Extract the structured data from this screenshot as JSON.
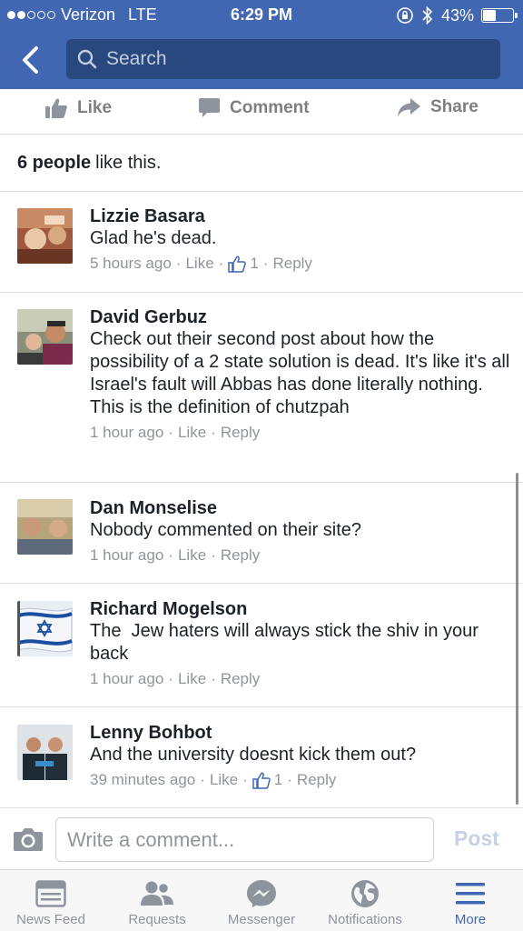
{
  "status_bar": {
    "carrier": "Verizon",
    "network": "LTE",
    "time": "6:29 PM",
    "battery": "43%",
    "battery_level": 0.43,
    "signal_bars_filled": 2,
    "signal_bars_total": 5
  },
  "nav": {
    "search_placeholder": "Search"
  },
  "actions": {
    "like": "Like",
    "comment": "Comment",
    "share": "Share"
  },
  "likes_summary": {
    "count_text": "6 people",
    "suffix": "like this."
  },
  "comments": [
    {
      "name": "Lizzie Basara",
      "text": "Glad he's dead.",
      "time": "5 hours ago",
      "like": "Like",
      "like_count": "1",
      "reply": "Reply"
    },
    {
      "name": "David Gerbuz",
      "text": "Check out their second post about how the possibility of a 2 state solution is dead. It's like it's all Israel's fault will Abbas has done literally nothing. This is the definition of chutzpah",
      "time": "1 hour ago",
      "like": "Like",
      "reply": "Reply"
    },
    {
      "name": "Dan Monselise",
      "text": "Nobody commented on their site?",
      "time": "1 hour ago",
      "like": "Like",
      "reply": "Reply"
    },
    {
      "name": "Richard Mogelson",
      "text": "The  Jew haters will always stick the shiv in your back",
      "time": "1 hour ago",
      "like": "Like",
      "reply": "Reply"
    },
    {
      "name": "Lenny Bohbot",
      "text": "And the university doesnt kick them out?",
      "time": "39 minutes ago",
      "like": "Like",
      "like_count": "1",
      "reply": "Reply"
    }
  ],
  "composer": {
    "placeholder": "Write a comment...",
    "post": "Post"
  },
  "tabbar": [
    {
      "label": "News Feed",
      "icon": "news-feed-icon"
    },
    {
      "label": "Requests",
      "icon": "friend-requests-icon"
    },
    {
      "label": "Messenger",
      "icon": "messenger-icon"
    },
    {
      "label": "Notifications",
      "icon": "globe-icon"
    },
    {
      "label": "More",
      "icon": "menu-icon",
      "active": true
    }
  ],
  "colors": {
    "brand_blue": "#4267b2",
    "search_bg": "#29487d",
    "muted_text": "#90949c"
  }
}
